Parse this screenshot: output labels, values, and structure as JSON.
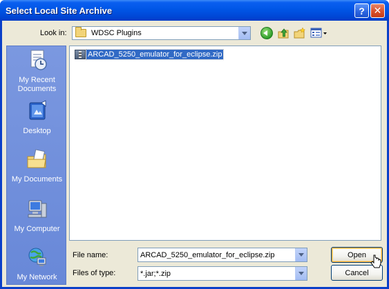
{
  "window": {
    "title": "Select Local Site Archive",
    "help_glyph": "?",
    "close_glyph": "✕"
  },
  "toolbar": {
    "look_in_label": "Look in:",
    "look_in_value": "WDSC Plugins",
    "icons": [
      "back-icon",
      "up-folder-icon",
      "new-folder-icon",
      "views-menu-icon"
    ]
  },
  "places": [
    {
      "label": "My Recent Documents",
      "icon": "recent-documents-icon"
    },
    {
      "label": "Desktop",
      "icon": "desktop-icon"
    },
    {
      "label": "My Documents",
      "icon": "my-documents-icon"
    },
    {
      "label": "My Computer",
      "icon": "my-computer-icon"
    },
    {
      "label": "My Network",
      "icon": "my-network-icon"
    }
  ],
  "files": [
    {
      "name": "ARCAD_5250_emulator_for_eclipse.zip",
      "selected": true,
      "icon": "archive-icon"
    }
  ],
  "form": {
    "file_name_label": "File name:",
    "file_name_value": "ARCAD_5250_emulator_for_eclipse.zip",
    "files_of_type_label": "Files of type:",
    "files_of_type_value": "*.jar;*.zip"
  },
  "buttons": {
    "open": "Open",
    "cancel": "Cancel"
  },
  "colors": {
    "titlebar": "#0054e3",
    "dialog_bg": "#ece9d8",
    "places_bar": "#7b98e0",
    "selection": "#316ac5"
  }
}
